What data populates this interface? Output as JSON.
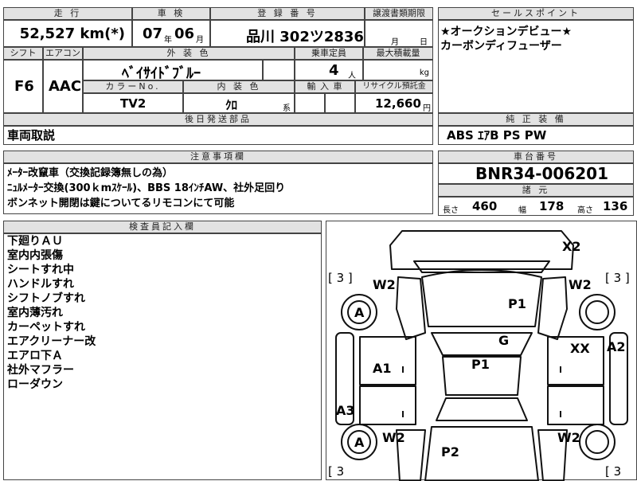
{
  "vehicle": {
    "mileage_label": "走 行",
    "mileage": "52,527 km(*)",
    "inspection_label": "車 検",
    "inspection_year": "07",
    "inspection_year_unit": "年",
    "inspection_month": "06",
    "inspection_month_unit": "月",
    "registration_label": "登 録 番 号",
    "registration": "品川 302ツ2836",
    "transfer_label": "譲渡書類期限",
    "transfer_month_unit": "月",
    "transfer_day_unit": "日",
    "shift_label": "シフト",
    "shift": "F6",
    "ac_label": "エアコン",
    "ac": "AAC",
    "exterior_color_label": "外 装 色",
    "exterior_color": "ﾍﾞｲｻｲﾄﾞﾌﾞﾙｰ",
    "capacity_label": "乗車定員",
    "capacity": "4",
    "capacity_unit": "人",
    "max_load_label": "最大積載量",
    "max_load_unit": "kg",
    "color_no_label": "カラーNo.",
    "color_no": "TV2",
    "interior_color_label": "内 装 色",
    "interior_color": "ｸﾛ",
    "interior_color_unit": "系",
    "import_label": "輸 入 車",
    "recycle_label": "リサイクル預託金",
    "recycle_fee": "12,660",
    "recycle_unit": "円"
  },
  "sales_point": {
    "title": "セールスポイント",
    "lines": [
      "★オークションデビュー★",
      "カーボンディフューザー"
    ]
  },
  "later_parts": {
    "title": "後日発送部品",
    "value": "車両取説"
  },
  "standard_equipment": {
    "title": "純 正 装 備",
    "value": "ABS ｴｱB PS PW"
  },
  "caution": {
    "title": "注意事項欄",
    "lines": [
      "ﾒｰﾀｰ改竄車（交換記録簿無しの為）",
      "ﾆｭﾙﾒｰﾀｰ交換(300ｋmｽｹｰﾙ)、BBS 18ｲﾝﾁAW、社外足回り",
      "ボンネット開閉は鍵についてるリモコンにて可能"
    ]
  },
  "chassis": {
    "title": "車台番号",
    "value": "BNR34-006201"
  },
  "specs": {
    "title": "諸 元",
    "length_label": "長さ",
    "length": "460",
    "width_label": "幅",
    "width": "178",
    "height_label": "高さ",
    "height": "136"
  },
  "inspector": {
    "title": "検査員記入欄",
    "lines": [
      "下廻りＡＵ",
      "室内内張傷",
      "シートすれ中",
      "ハンドルすれ",
      "シフトノブすれ",
      "室内薄汚れ",
      "カーペットすれ",
      "エアクリーナー改",
      "エアロ下Ａ",
      "社外マフラー",
      "ローダウン"
    ]
  },
  "diagram": {
    "tire_tl": "[ 3 ]",
    "tire_tr": "[ 3 ]",
    "tire_bl": "[ 3",
    "tire_br": "[ 3",
    "marks": {
      "x2": "X2",
      "w2_tl": "W2",
      "w2_tr": "W2",
      "w2_bl": "W2",
      "w2_br": "W2",
      "a_front": "A",
      "a_rear": "A",
      "p1_hood": "P1",
      "p1_roof": "P1",
      "g": "G",
      "xx": "XX",
      "a2": "A2",
      "a1": "A1",
      "a3": "A3",
      "p2": "P2"
    }
  }
}
